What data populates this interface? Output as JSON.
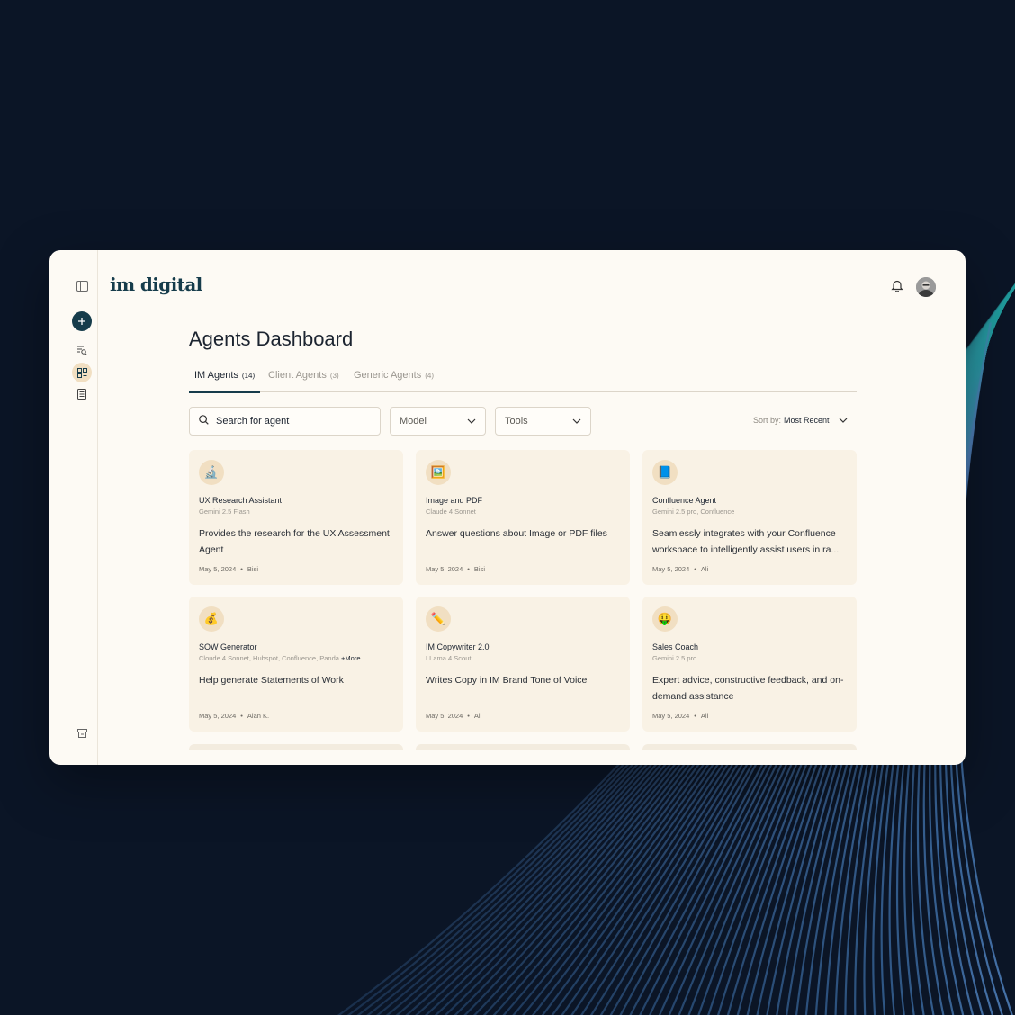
{
  "app": {
    "logo": "im digital"
  },
  "header": {
    "notifications_icon": "bell-icon",
    "avatar_icon": "user-avatar"
  },
  "page": {
    "title": "Agents Dashboard"
  },
  "tabs": [
    {
      "label": "IM Agents",
      "count": "(14)",
      "active": true
    },
    {
      "label": "Client Agents",
      "count": "(3)",
      "active": false
    },
    {
      "label": "Generic Agents",
      "count": "(4)",
      "active": false
    }
  ],
  "filters": {
    "search_placeholder": "Search for agent",
    "model_label": "Model",
    "tools_label": "Tools",
    "sort_prefix": "Sort by:",
    "sort_value": "Most Recent"
  },
  "agents": [
    {
      "emoji": "🔬",
      "name": "UX Research Assistant",
      "model": "Gemini 2.5 Flash",
      "more": "",
      "description": "Provides the research for the UX Assessment Agent",
      "date": "May 5, 2024",
      "author": "Bisi"
    },
    {
      "emoji": "🖼️",
      "name": "Image and PDF",
      "model": "Claude 4 Sonnet",
      "more": "",
      "description": "Answer questions about Image or PDF files",
      "date": "May 5, 2024",
      "author": "Bisi"
    },
    {
      "emoji": "📘",
      "name": "Confluence Agent",
      "model": "Gemini 2.5 pro,  Confluence",
      "more": "",
      "description": "Seamlessly integrates with your Confluence workspace to intelligently assist users in ra...",
      "date": "May 5, 2024",
      "author": "Ali"
    },
    {
      "emoji": "💰",
      "name": "SOW Generator",
      "model": "Cloude 4 Sonnet,  Hubspot,  Confluence,  Panda",
      "more": "+More",
      "description": "Help generate Statements of Work",
      "date": "May 5, 2024",
      "author": "Alan K."
    },
    {
      "emoji": "✏️",
      "name": "IM Copywriter 2.0",
      "model": "LLama 4 Scout",
      "more": "",
      "description": "Writes Copy in IM Brand Tone of Voice",
      "date": "May 5, 2024",
      "author": "Ali"
    },
    {
      "emoji": "🤑",
      "name": "Sales Coach",
      "model": "Gemini 2.5 pro",
      "more": "",
      "description": "Expert advice, constructive feedback, and on-demand assistance",
      "date": "May 5, 2024",
      "author": "Ali"
    }
  ],
  "meta_separator": "•"
}
